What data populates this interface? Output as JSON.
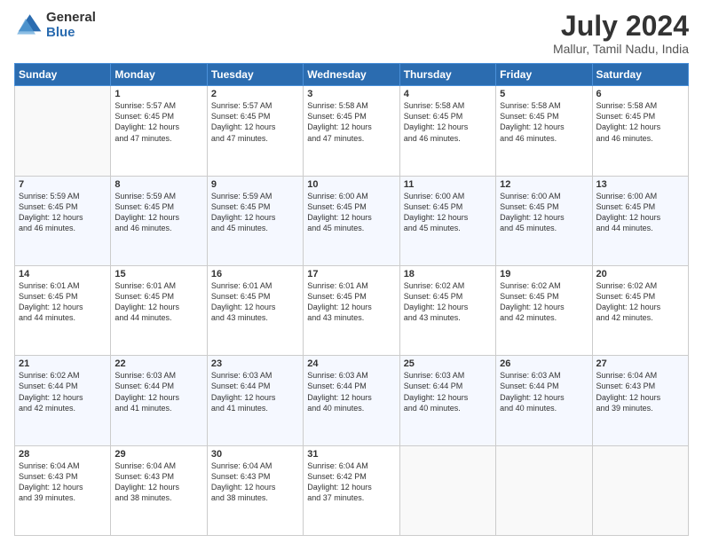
{
  "header": {
    "logo_general": "General",
    "logo_blue": "Blue",
    "title": "July 2024",
    "subtitle": "Mallur, Tamil Nadu, India"
  },
  "columns": [
    "Sunday",
    "Monday",
    "Tuesday",
    "Wednesday",
    "Thursday",
    "Friday",
    "Saturday"
  ],
  "weeks": [
    {
      "days": [
        {
          "number": "",
          "lines": []
        },
        {
          "number": "1",
          "lines": [
            "Sunrise: 5:57 AM",
            "Sunset: 6:45 PM",
            "Daylight: 12 hours",
            "and 47 minutes."
          ]
        },
        {
          "number": "2",
          "lines": [
            "Sunrise: 5:57 AM",
            "Sunset: 6:45 PM",
            "Daylight: 12 hours",
            "and 47 minutes."
          ]
        },
        {
          "number": "3",
          "lines": [
            "Sunrise: 5:58 AM",
            "Sunset: 6:45 PM",
            "Daylight: 12 hours",
            "and 47 minutes."
          ]
        },
        {
          "number": "4",
          "lines": [
            "Sunrise: 5:58 AM",
            "Sunset: 6:45 PM",
            "Daylight: 12 hours",
            "and 46 minutes."
          ]
        },
        {
          "number": "5",
          "lines": [
            "Sunrise: 5:58 AM",
            "Sunset: 6:45 PM",
            "Daylight: 12 hours",
            "and 46 minutes."
          ]
        },
        {
          "number": "6",
          "lines": [
            "Sunrise: 5:58 AM",
            "Sunset: 6:45 PM",
            "Daylight: 12 hours",
            "and 46 minutes."
          ]
        }
      ]
    },
    {
      "days": [
        {
          "number": "7",
          "lines": [
            "Sunrise: 5:59 AM",
            "Sunset: 6:45 PM",
            "Daylight: 12 hours",
            "and 46 minutes."
          ]
        },
        {
          "number": "8",
          "lines": [
            "Sunrise: 5:59 AM",
            "Sunset: 6:45 PM",
            "Daylight: 12 hours",
            "and 46 minutes."
          ]
        },
        {
          "number": "9",
          "lines": [
            "Sunrise: 5:59 AM",
            "Sunset: 6:45 PM",
            "Daylight: 12 hours",
            "and 45 minutes."
          ]
        },
        {
          "number": "10",
          "lines": [
            "Sunrise: 6:00 AM",
            "Sunset: 6:45 PM",
            "Daylight: 12 hours",
            "and 45 minutes."
          ]
        },
        {
          "number": "11",
          "lines": [
            "Sunrise: 6:00 AM",
            "Sunset: 6:45 PM",
            "Daylight: 12 hours",
            "and 45 minutes."
          ]
        },
        {
          "number": "12",
          "lines": [
            "Sunrise: 6:00 AM",
            "Sunset: 6:45 PM",
            "Daylight: 12 hours",
            "and 45 minutes."
          ]
        },
        {
          "number": "13",
          "lines": [
            "Sunrise: 6:00 AM",
            "Sunset: 6:45 PM",
            "Daylight: 12 hours",
            "and 44 minutes."
          ]
        }
      ]
    },
    {
      "days": [
        {
          "number": "14",
          "lines": [
            "Sunrise: 6:01 AM",
            "Sunset: 6:45 PM",
            "Daylight: 12 hours",
            "and 44 minutes."
          ]
        },
        {
          "number": "15",
          "lines": [
            "Sunrise: 6:01 AM",
            "Sunset: 6:45 PM",
            "Daylight: 12 hours",
            "and 44 minutes."
          ]
        },
        {
          "number": "16",
          "lines": [
            "Sunrise: 6:01 AM",
            "Sunset: 6:45 PM",
            "Daylight: 12 hours",
            "and 43 minutes."
          ]
        },
        {
          "number": "17",
          "lines": [
            "Sunrise: 6:01 AM",
            "Sunset: 6:45 PM",
            "Daylight: 12 hours",
            "and 43 minutes."
          ]
        },
        {
          "number": "18",
          "lines": [
            "Sunrise: 6:02 AM",
            "Sunset: 6:45 PM",
            "Daylight: 12 hours",
            "and 43 minutes."
          ]
        },
        {
          "number": "19",
          "lines": [
            "Sunrise: 6:02 AM",
            "Sunset: 6:45 PM",
            "Daylight: 12 hours",
            "and 42 minutes."
          ]
        },
        {
          "number": "20",
          "lines": [
            "Sunrise: 6:02 AM",
            "Sunset: 6:45 PM",
            "Daylight: 12 hours",
            "and 42 minutes."
          ]
        }
      ]
    },
    {
      "days": [
        {
          "number": "21",
          "lines": [
            "Sunrise: 6:02 AM",
            "Sunset: 6:44 PM",
            "Daylight: 12 hours",
            "and 42 minutes."
          ]
        },
        {
          "number": "22",
          "lines": [
            "Sunrise: 6:03 AM",
            "Sunset: 6:44 PM",
            "Daylight: 12 hours",
            "and 41 minutes."
          ]
        },
        {
          "number": "23",
          "lines": [
            "Sunrise: 6:03 AM",
            "Sunset: 6:44 PM",
            "Daylight: 12 hours",
            "and 41 minutes."
          ]
        },
        {
          "number": "24",
          "lines": [
            "Sunrise: 6:03 AM",
            "Sunset: 6:44 PM",
            "Daylight: 12 hours",
            "and 40 minutes."
          ]
        },
        {
          "number": "25",
          "lines": [
            "Sunrise: 6:03 AM",
            "Sunset: 6:44 PM",
            "Daylight: 12 hours",
            "and 40 minutes."
          ]
        },
        {
          "number": "26",
          "lines": [
            "Sunrise: 6:03 AM",
            "Sunset: 6:44 PM",
            "Daylight: 12 hours",
            "and 40 minutes."
          ]
        },
        {
          "number": "27",
          "lines": [
            "Sunrise: 6:04 AM",
            "Sunset: 6:43 PM",
            "Daylight: 12 hours",
            "and 39 minutes."
          ]
        }
      ]
    },
    {
      "days": [
        {
          "number": "28",
          "lines": [
            "Sunrise: 6:04 AM",
            "Sunset: 6:43 PM",
            "Daylight: 12 hours",
            "and 39 minutes."
          ]
        },
        {
          "number": "29",
          "lines": [
            "Sunrise: 6:04 AM",
            "Sunset: 6:43 PM",
            "Daylight: 12 hours",
            "and 38 minutes."
          ]
        },
        {
          "number": "30",
          "lines": [
            "Sunrise: 6:04 AM",
            "Sunset: 6:43 PM",
            "Daylight: 12 hours",
            "and 38 minutes."
          ]
        },
        {
          "number": "31",
          "lines": [
            "Sunrise: 6:04 AM",
            "Sunset: 6:42 PM",
            "Daylight: 12 hours",
            "and 37 minutes."
          ]
        },
        {
          "number": "",
          "lines": []
        },
        {
          "number": "",
          "lines": []
        },
        {
          "number": "",
          "lines": []
        }
      ]
    }
  ]
}
